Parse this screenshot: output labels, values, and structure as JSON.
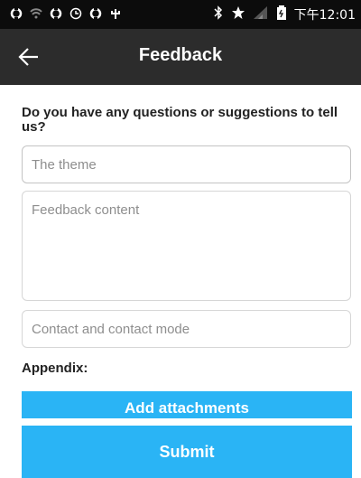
{
  "status_bar": {
    "time": "下午12:01",
    "icons": [
      "sync-icon",
      "wifi-icon",
      "sync-icon",
      "clock-icon",
      "sync-icon",
      "usb-icon",
      "bluetooth-icon",
      "star-icon",
      "signal-icon",
      "battery-icon"
    ]
  },
  "header": {
    "title": "Feedback",
    "back_icon": "arrow-left-icon"
  },
  "form": {
    "question": "Do you have any questions or suggestions to tell us?",
    "theme_placeholder": "The theme",
    "content_placeholder": "Feedback content",
    "contact_placeholder": "Contact and contact mode",
    "appendix_label": "Appendix:",
    "attach_label": "Add attachments",
    "submit_label": "Submit"
  },
  "colors": {
    "accent": "#2ab4f5",
    "header": "#2c2c2c",
    "status": "#0c0c0c"
  }
}
